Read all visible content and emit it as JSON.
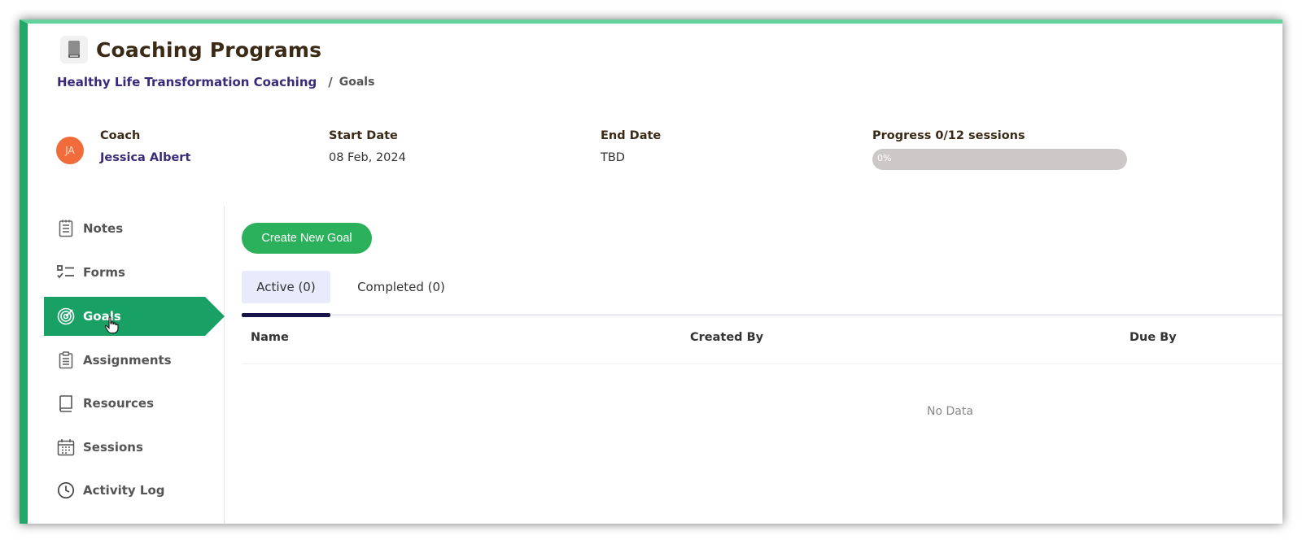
{
  "header": {
    "title": "Coaching Programs",
    "title_icon": "book-icon"
  },
  "breadcrumb": {
    "program": "Healthy Life Transformation Coaching",
    "separator": "/",
    "current": "Goals"
  },
  "summary": {
    "coach_label": "Coach",
    "coach_initials": "JA",
    "coach_name": "Jessica Albert",
    "start_label": "Start Date",
    "start_value": "08 Feb, 2024",
    "end_label": "End Date",
    "end_value": "TBD",
    "progress_label": "Progress 0/12 sessions",
    "progress_text": "0%",
    "progress_fraction": 0
  },
  "sidebar": {
    "items": [
      {
        "label": "Notes",
        "icon": "notes-icon"
      },
      {
        "label": "Forms",
        "icon": "checklist-icon"
      },
      {
        "label": "Goals",
        "icon": "target-icon",
        "active": true
      },
      {
        "label": "Assignments",
        "icon": "clipboard-icon"
      },
      {
        "label": "Resources",
        "icon": "book-outline-icon"
      },
      {
        "label": "Sessions",
        "icon": "calendar-icon"
      },
      {
        "label": "Activity Log",
        "icon": "clock-icon"
      }
    ]
  },
  "content": {
    "create_button": "Create New Goal",
    "tabs": [
      {
        "label": "Active (0)",
        "active": true
      },
      {
        "label": "Completed (0)",
        "active": false
      }
    ],
    "table": {
      "columns": [
        "Name",
        "Created By",
        "Due By"
      ],
      "rows": [],
      "empty_text": "No Data"
    }
  },
  "colors": {
    "accent": "#22a96a",
    "active_nav": "#18a065",
    "button": "#2bb05c",
    "tab_indicator": "#17134a",
    "link": "#3b2a7a",
    "avatar": "#f26b3a"
  }
}
